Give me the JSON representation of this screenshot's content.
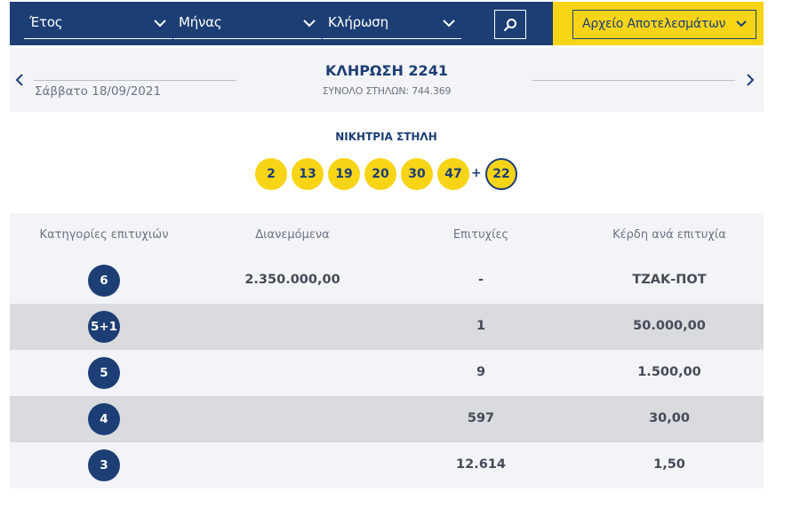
{
  "filters": {
    "year": {
      "label": "Έτος",
      "icon": "chevron-down-icon"
    },
    "month": {
      "label": "Μήνας",
      "icon": "chevron-down-icon"
    },
    "draw": {
      "label": "Κλήρωση",
      "icon": "chevron-down-icon"
    },
    "search": {
      "icon": "search-icon"
    },
    "archive": {
      "label": "Αρχείο Αποτελεσμάτων",
      "icon": "chevron-down-icon"
    }
  },
  "draw": {
    "title": "ΚΛΗΡΩΣΗ 2241",
    "date": "Σάββατο 18/09/2021",
    "total_columns": "ΣΥΝΟΛΟ ΣΤΗΛΩΝ: 744.369",
    "prev_icon": "chevron-left-icon",
    "next_icon": "chevron-right-icon"
  },
  "winning": {
    "label": "ΝΙΚΗΤΡΙΑ ΣΤΗΛΗ",
    "numbers": [
      "2",
      "13",
      "19",
      "20",
      "30",
      "47"
    ],
    "plus": "+",
    "bonus": "22"
  },
  "table": {
    "headers": [
      "Κατηγορίες επιτυχιών",
      "Διανεμόμενα",
      "Επιτυχίες",
      "Κέρδη ανά επιτυχία"
    ],
    "rows": [
      {
        "category": "6",
        "distributed": "2.350.000,00",
        "winners": "-",
        "prize": "ΤΖΑΚ-ΠΟΤ"
      },
      {
        "category": "5+1",
        "distributed": "",
        "winners": "1",
        "prize": "50.000,00"
      },
      {
        "category": "5",
        "distributed": "",
        "winners": "9",
        "prize": "1.500,00"
      },
      {
        "category": "4",
        "distributed": "",
        "winners": "597",
        "prize": "30,00"
      },
      {
        "category": "3",
        "distributed": "",
        "winners": "12.614",
        "prize": "1,50"
      }
    ]
  },
  "colors": {
    "navy": "#1d3e74",
    "yellow": "#f7d416",
    "row_light": "#f3f4f7",
    "row_dark": "#d9dbdf"
  }
}
